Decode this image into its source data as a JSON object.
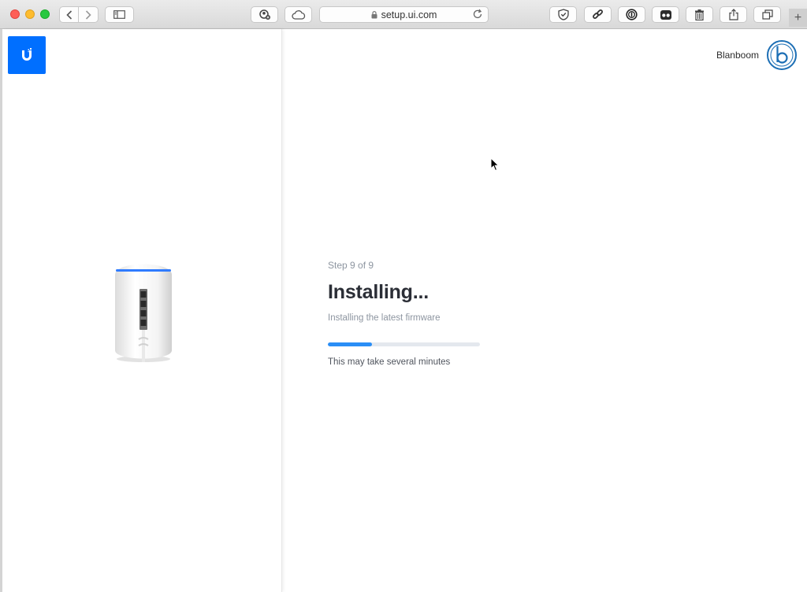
{
  "browser": {
    "url": "setup.ui.com",
    "icons": [
      "back-icon",
      "forward-icon",
      "sidebar-icon",
      "privacy-icon",
      "icloud-icon",
      "shield-icon",
      "link-icon",
      "password-icon",
      "extensions-icon",
      "trash-icon",
      "share-icon",
      "tabs-icon"
    ],
    "new_tab_label": "+"
  },
  "header": {
    "user_name": "Blanboom",
    "avatar_letter": "b"
  },
  "setup": {
    "step": "Step 9 of 9",
    "title": "Installing...",
    "subtitle": "Installing the latest firmware",
    "progress_fraction": 0.29,
    "note": "This may take several minutes"
  },
  "colors": {
    "brand": "#006fff",
    "progress": "#2a8ef6",
    "progress_track": "#e4e8ee"
  }
}
